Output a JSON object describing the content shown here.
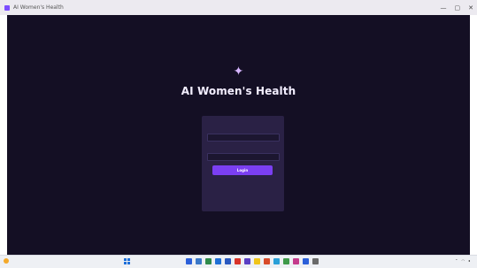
{
  "window": {
    "title": "AI Women's Health",
    "controls": [
      "—",
      "▢",
      "✕"
    ]
  },
  "app": {
    "logo_icon": "sparkle-icon",
    "headline": "AI Women's Health",
    "subtitle": "",
    "card": {
      "title": "",
      "email_label": "",
      "email_value": "",
      "email_pill": "",
      "password_label": "",
      "password_value": "",
      "login_label": "Login",
      "divider_text": "",
      "signup_label": ""
    },
    "footer": ""
  },
  "colors": {
    "background": "#140f24",
    "card": "#2a2145",
    "accent": "#7b3ff2",
    "logo": "#d6b5ff"
  },
  "taskbar": {
    "weather_icon": "sun-icon",
    "temperature": "",
    "search_placeholder": "",
    "app_colors": [
      "#2b5fd9",
      "#3a78c8",
      "#2f8a4a",
      "#1f6fd6",
      "#2a59c0",
      "#d9342a",
      "#5a3fc4",
      "#f0c419",
      "#d84b2a",
      "#2aa0d8",
      "#3f9a4a",
      "#c43a8c",
      "#2b5fd9",
      "#6a6a6a"
    ],
    "clock_time": "",
    "clock_date": ""
  }
}
